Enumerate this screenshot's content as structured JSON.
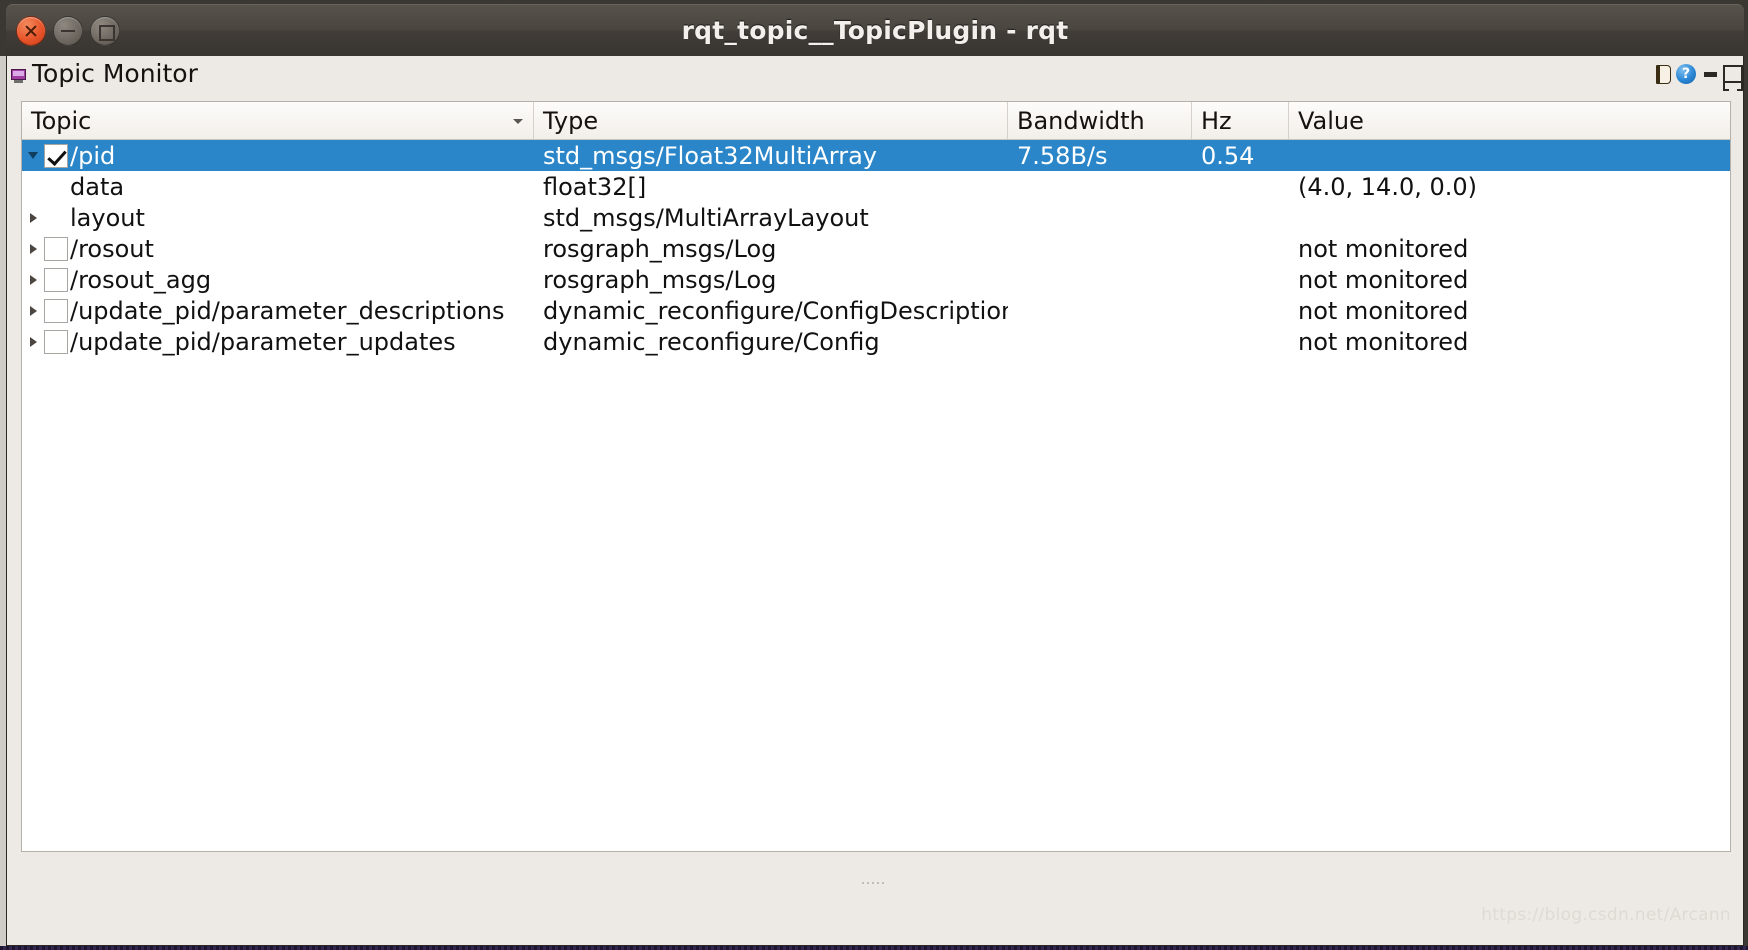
{
  "window": {
    "title": "rqt_topic__TopicPlugin - rqt",
    "controls": {
      "close": "close-button",
      "minimize": "minimize-button",
      "maximize": "maximize-button"
    }
  },
  "dock": {
    "title": "Topic Monitor",
    "icon": "monitor-icon",
    "actions": [
      {
        "name": "documentation-icon",
        "label": ""
      },
      {
        "name": "help-icon",
        "label": "?"
      },
      {
        "name": "minimize-dock-icon",
        "label": ""
      },
      {
        "name": "float-dock-icon",
        "label": ""
      }
    ]
  },
  "table": {
    "columns": [
      {
        "key": "topic",
        "label": "Topic",
        "sorted": "descending"
      },
      {
        "key": "type",
        "label": "Type",
        "sorted": ""
      },
      {
        "key": "bandwidth",
        "label": "Bandwidth",
        "sorted": ""
      },
      {
        "key": "hz",
        "label": "Hz",
        "sorted": ""
      },
      {
        "key": "value",
        "label": "Value",
        "sorted": ""
      }
    ],
    "rows": [
      {
        "topic": "/pid",
        "type": "std_msgs/Float32MultiArray",
        "bandwidth": "7.58B/s",
        "hz": "0.54",
        "value": "",
        "depth": 0,
        "expander": "expanded",
        "checkbox": "checked",
        "selected": true
      },
      {
        "topic": "data",
        "type": "float32[]",
        "bandwidth": "",
        "hz": "",
        "value": "(4.0, 14.0, 0.0)",
        "depth": 1,
        "expander": "none",
        "checkbox": "none",
        "selected": false
      },
      {
        "topic": "layout",
        "type": "std_msgs/MultiArrayLayout",
        "bandwidth": "",
        "hz": "",
        "value": "",
        "depth": 1,
        "expander": "collapsed",
        "checkbox": "none",
        "selected": false
      },
      {
        "topic": "/rosout",
        "type": "rosgraph_msgs/Log",
        "bandwidth": "",
        "hz": "",
        "value": "not monitored",
        "depth": 0,
        "expander": "collapsed",
        "checkbox": "unchecked",
        "selected": false
      },
      {
        "topic": "/rosout_agg",
        "type": "rosgraph_msgs/Log",
        "bandwidth": "",
        "hz": "",
        "value": "not monitored",
        "depth": 0,
        "expander": "collapsed",
        "checkbox": "unchecked",
        "selected": false
      },
      {
        "topic": "/update_pid/parameter_descriptions",
        "type": "dynamic_reconfigure/ConfigDescription",
        "bandwidth": "",
        "hz": "",
        "value": "not monitored",
        "depth": 0,
        "expander": "collapsed",
        "checkbox": "unchecked",
        "selected": false
      },
      {
        "topic": "/update_pid/parameter_updates",
        "type": "dynamic_reconfigure/Config",
        "bandwidth": "",
        "hz": "",
        "value": "not monitored",
        "depth": 0,
        "expander": "collapsed",
        "checkbox": "unchecked",
        "selected": false
      }
    ]
  },
  "footer": {
    "watermark": "https://blog.csdn.net/Arcann"
  },
  "colors": {
    "selection": "#2a86c8",
    "window_chrome": "#4a453f",
    "client_background": "#edeae5",
    "table_background": "#ffffff",
    "close_button": "#e8542a",
    "help_icon": "#2b86d4"
  }
}
